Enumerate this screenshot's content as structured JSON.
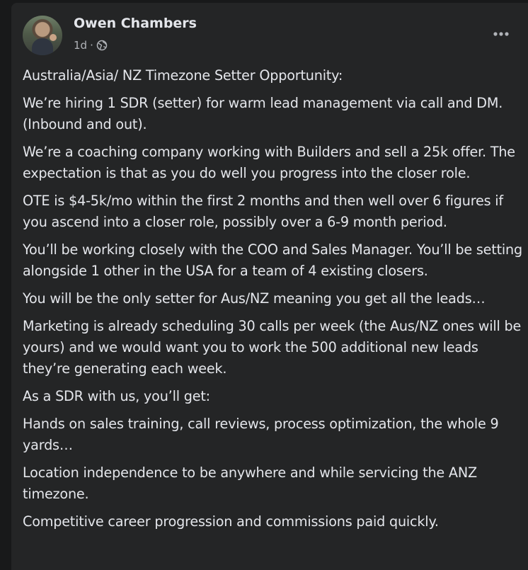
{
  "post": {
    "author": "Owen Chambers",
    "time": "1d",
    "separator": "·",
    "privacy_icon": "globe-icon",
    "more_icon": "more-options-icon",
    "paragraphs": [
      "Australia/Asia/ NZ Timezone Setter Opportunity:",
      "We’re hiring 1 SDR (setter) for warm lead management via call and DM. (Inbound and out).",
      "We’re a coaching company working with Builders and sell a 25k offer. The expectation is that as you do well you progress into the closer role.",
      "OTE is $4-5k/mo within the first 2 months and then well over 6 figures if you ascend into a closer role, possibly over a 6-9 month period.",
      "You’ll be working closely with the COO and Sales Manager. You’ll be setting alongside 1 other in the USA for a team of 4 existing closers.",
      "You will be the only setter for Aus/NZ meaning you get all the leads…",
      "Marketing is already scheduling 30 calls per week (the Aus/NZ ones will be yours) and we would want you to work the 500 additional new leads they’re generating each week.",
      "As a SDR with us, you’ll get:",
      "Hands on sales training, call reviews, process optimization, the whole 9 yards…",
      "Location independence to be anywhere and while servicing the ANZ timezone.",
      "Competitive career progression and commissions paid quickly."
    ]
  },
  "colors": {
    "page_background": "#18191a",
    "card_background": "#242526",
    "primary_text": "#e4e6eb",
    "secondary_text": "#b0b3b8"
  }
}
